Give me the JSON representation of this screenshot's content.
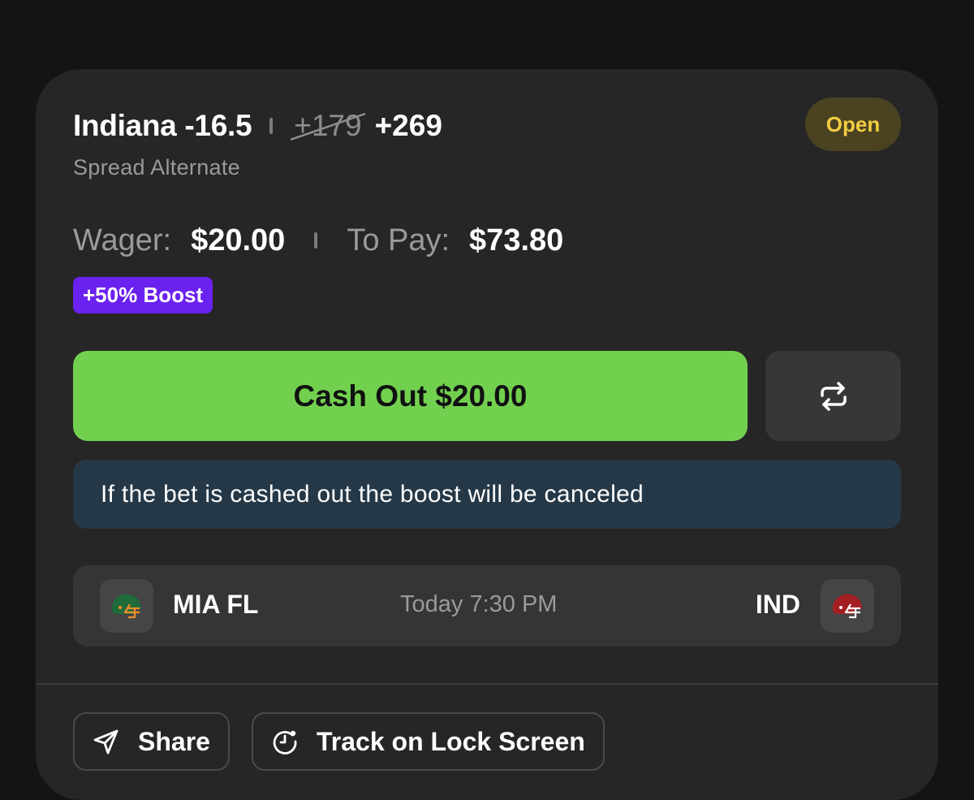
{
  "bet": {
    "selection": "Indiana -16.5",
    "old_odds": "+179",
    "new_odds": "+269",
    "status": "Open",
    "market": "Spread Alternate"
  },
  "amounts": {
    "wager_label": "Wager:",
    "wager_value": "$20.00",
    "to_pay_label": "To Pay:",
    "to_pay_value": "$73.80"
  },
  "boost_badge": "+50% Boost",
  "cash_out_label": "Cash Out $20.00",
  "info_message": "If the bet is cashed out the boost will be canceled",
  "game": {
    "away_team": "MIA FL",
    "time": "Today 7:30 PM",
    "home_team": "IND"
  },
  "actions": {
    "share_label": "Share",
    "track_label": "Track on Lock Screen"
  },
  "colors": {
    "background": "#141414",
    "card": "#262626",
    "cash_out": "#72d04f",
    "boost": "#6b21f0",
    "status_open_text": "#f2cd41",
    "status_open_bg": "#4a4221",
    "info_bg": "#253847",
    "away_helmet": "#1f6b3a",
    "home_helmet": "#a51e22"
  },
  "icons": {
    "swap": "swap-arrows-icon",
    "share": "send-paper-plane-icon",
    "track": "lock-screen-clock-icon",
    "away_logo": "football-helmet-icon",
    "home_logo": "football-helmet-icon"
  }
}
